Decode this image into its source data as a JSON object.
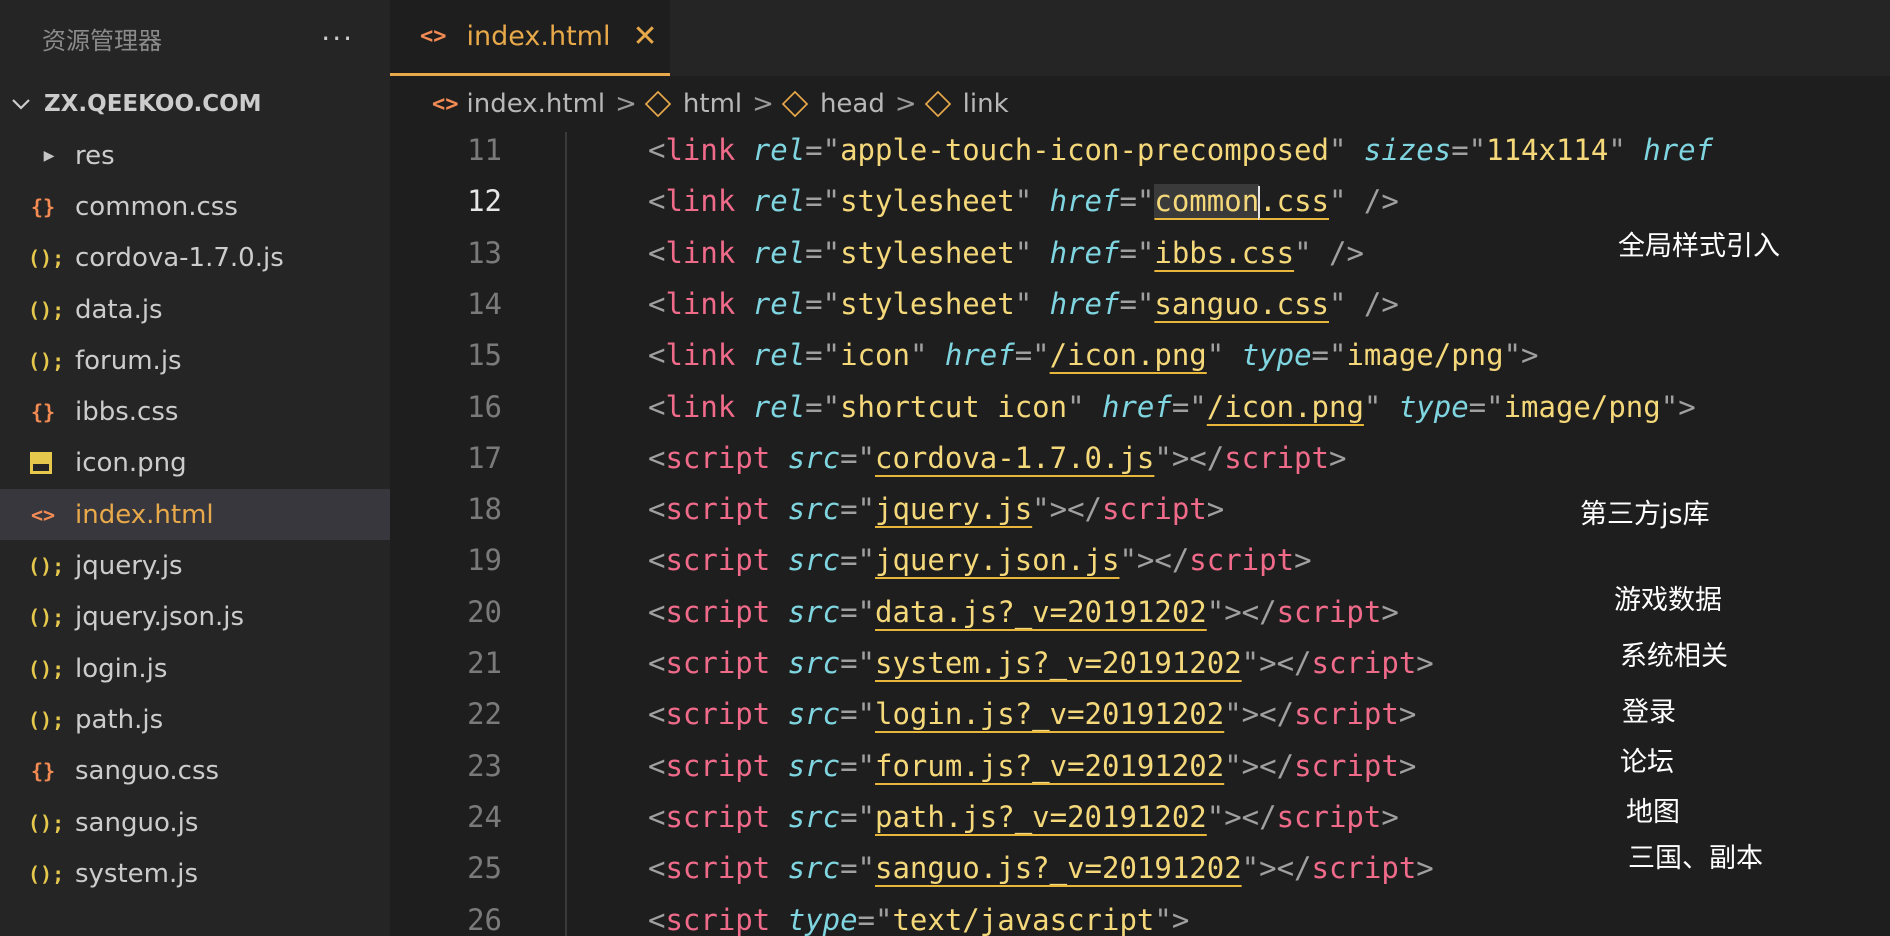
{
  "explorer": {
    "title": "资源管理器",
    "more": "···",
    "section": "ZX.QEEKOO.COM",
    "items": [
      {
        "label": "res",
        "icon": "▶",
        "kind": "folder"
      },
      {
        "label": "common.css",
        "icon": "{}",
        "kind": "css"
      },
      {
        "label": "cordova-1.7.0.js",
        "icon": "();",
        "kind": "js"
      },
      {
        "label": "data.js",
        "icon": "();",
        "kind": "js"
      },
      {
        "label": "forum.js",
        "icon": "();",
        "kind": "js"
      },
      {
        "label": "ibbs.css",
        "icon": "{}",
        "kind": "css"
      },
      {
        "label": "icon.png",
        "icon": "",
        "kind": "image"
      },
      {
        "label": "index.html",
        "icon": "<>",
        "kind": "html"
      },
      {
        "label": "jquery.js",
        "icon": "();",
        "kind": "js"
      },
      {
        "label": "jquery.json.js",
        "icon": "();",
        "kind": "js"
      },
      {
        "label": "login.js",
        "icon": "();",
        "kind": "js"
      },
      {
        "label": "path.js",
        "icon": "();",
        "kind": "js"
      },
      {
        "label": "sanguo.css",
        "icon": "{}",
        "kind": "css"
      },
      {
        "label": "sanguo.js",
        "icon": "();",
        "kind": "js"
      },
      {
        "label": "system.js",
        "icon": "();",
        "kind": "js"
      }
    ]
  },
  "tab": {
    "label": "index.html",
    "icon": "<>",
    "close": "✕"
  },
  "breadcrumb": {
    "file": "index.html",
    "sep": ">",
    "items": [
      "html",
      "head",
      "link"
    ]
  },
  "lines": [
    {
      "n": "11",
      "p": [
        "<"
      ],
      "tag": "link",
      "rest": [
        [
          "a",
          "rel"
        ],
        [
          "p",
          "=\""
        ],
        [
          "s",
          "apple-touch-icon-precomposed"
        ],
        [
          "p",
          "\" "
        ],
        [
          "a",
          "sizes"
        ],
        [
          "p",
          "=\""
        ],
        [
          "s",
          "114x114"
        ],
        [
          "p",
          "\" "
        ],
        [
          "a",
          "href"
        ]
      ]
    },
    {
      "n": "12",
      "tag": "link",
      "rest": [
        [
          "a",
          "rel"
        ],
        [
          "p",
          "=\""
        ],
        [
          "s",
          "stylesheet"
        ],
        [
          "p",
          "\" "
        ],
        [
          "a",
          "href"
        ],
        [
          "p",
          "=\""
        ],
        [
          "uc",
          "common"
        ],
        [
          "u",
          ".css"
        ],
        [
          "p",
          "\" />"
        ]
      ]
    },
    {
      "n": "13",
      "tag": "link",
      "rest": [
        [
          "a",
          "rel"
        ],
        [
          "p",
          "=\""
        ],
        [
          "s",
          "stylesheet"
        ],
        [
          "p",
          "\" "
        ],
        [
          "a",
          "href"
        ],
        [
          "p",
          "=\""
        ],
        [
          "u",
          "ibbs.css"
        ],
        [
          "p",
          "\" />"
        ]
      ]
    },
    {
      "n": "14",
      "tag": "link",
      "rest": [
        [
          "a",
          "rel"
        ],
        [
          "p",
          "=\""
        ],
        [
          "s",
          "stylesheet"
        ],
        [
          "p",
          "\" "
        ],
        [
          "a",
          "href"
        ],
        [
          "p",
          "=\""
        ],
        [
          "u",
          "sanguo.css"
        ],
        [
          "p",
          "\" />"
        ]
      ]
    },
    {
      "n": "15",
      "tag": "link",
      "rest": [
        [
          "a",
          "rel"
        ],
        [
          "p",
          "=\""
        ],
        [
          "s",
          "icon"
        ],
        [
          "p",
          "\" "
        ],
        [
          "a",
          "href"
        ],
        [
          "p",
          "=\""
        ],
        [
          "u",
          "/icon.png"
        ],
        [
          "p",
          "\" "
        ],
        [
          "a",
          "type"
        ],
        [
          "p",
          "=\""
        ],
        [
          "s",
          "image/png"
        ],
        [
          "p",
          "\">"
        ]
      ]
    },
    {
      "n": "16",
      "tag": "link",
      "rest": [
        [
          "a",
          "rel"
        ],
        [
          "p",
          "=\""
        ],
        [
          "s",
          "shortcut icon"
        ],
        [
          "p",
          "\" "
        ],
        [
          "a",
          "href"
        ],
        [
          "p",
          "=\""
        ],
        [
          "u",
          "/icon.png"
        ],
        [
          "p",
          "\" "
        ],
        [
          "a",
          "type"
        ],
        [
          "p",
          "=\""
        ],
        [
          "s",
          "image/png"
        ],
        [
          "p",
          "\">"
        ]
      ]
    },
    {
      "n": "17",
      "tag": "script",
      "rest": [
        [
          "a",
          "src"
        ],
        [
          "p",
          "=\""
        ],
        [
          "u",
          "cordova-1.7.0.js"
        ],
        [
          "p",
          "\"></"
        ],
        [
          "t",
          "script"
        ],
        [
          "p",
          ">"
        ]
      ]
    },
    {
      "n": "18",
      "tag": "script",
      "rest": [
        [
          "a",
          "src"
        ],
        [
          "p",
          "=\""
        ],
        [
          "u",
          "jquery.js"
        ],
        [
          "p",
          "\"></"
        ],
        [
          "t",
          "script"
        ],
        [
          "p",
          ">"
        ]
      ]
    },
    {
      "n": "19",
      "tag": "script",
      "rest": [
        [
          "a",
          "src"
        ],
        [
          "p",
          "=\""
        ],
        [
          "u",
          "jquery.json.js"
        ],
        [
          "p",
          "\"></"
        ],
        [
          "t",
          "script"
        ],
        [
          "p",
          ">"
        ]
      ]
    },
    {
      "n": "20",
      "tag": "script",
      "rest": [
        [
          "a",
          "src"
        ],
        [
          "p",
          "=\""
        ],
        [
          "u",
          "data.js?_v=20191202"
        ],
        [
          "p",
          "\"></"
        ],
        [
          "t",
          "script"
        ],
        [
          "p",
          ">"
        ]
      ]
    },
    {
      "n": "21",
      "tag": "script",
      "rest": [
        [
          "a",
          "src"
        ],
        [
          "p",
          "=\""
        ],
        [
          "u",
          "system.js?_v=20191202"
        ],
        [
          "p",
          "\"></"
        ],
        [
          "t",
          "script"
        ],
        [
          "p",
          ">"
        ]
      ]
    },
    {
      "n": "22",
      "tag": "script",
      "rest": [
        [
          "a",
          "src"
        ],
        [
          "p",
          "=\""
        ],
        [
          "u",
          "login.js?_v=20191202"
        ],
        [
          "p",
          "\"></"
        ],
        [
          "t",
          "script"
        ],
        [
          "p",
          ">"
        ]
      ]
    },
    {
      "n": "23",
      "tag": "script",
      "rest": [
        [
          "a",
          "src"
        ],
        [
          "p",
          "=\""
        ],
        [
          "u",
          "forum.js?_v=20191202"
        ],
        [
          "p",
          "\"></"
        ],
        [
          "t",
          "script"
        ],
        [
          "p",
          ">"
        ]
      ]
    },
    {
      "n": "24",
      "tag": "script",
      "rest": [
        [
          "a",
          "src"
        ],
        [
          "p",
          "=\""
        ],
        [
          "u",
          "path.js?_v=20191202"
        ],
        [
          "p",
          "\"></"
        ],
        [
          "t",
          "script"
        ],
        [
          "p",
          ">"
        ]
      ]
    },
    {
      "n": "25",
      "tag": "script",
      "rest": [
        [
          "a",
          "src"
        ],
        [
          "p",
          "=\""
        ],
        [
          "u",
          "sanguo.js?_v=20191202"
        ],
        [
          "p",
          "\"></"
        ],
        [
          "t",
          "script"
        ],
        [
          "p",
          ">"
        ]
      ]
    },
    {
      "n": "26",
      "tag": "script",
      "rest": [
        [
          "a",
          "type"
        ],
        [
          "p",
          "=\""
        ],
        [
          "s",
          "text/javascript"
        ],
        [
          "p",
          "\">"
        ]
      ]
    }
  ],
  "current_line": "12",
  "annotations": {
    "global_styles": "全局样式引入",
    "third_party": "第三方js库",
    "game_data": "游戏数据",
    "system": "系统相关",
    "login": "登录",
    "forum": "论坛",
    "map": "地图",
    "sanguo": "三国、副本"
  }
}
